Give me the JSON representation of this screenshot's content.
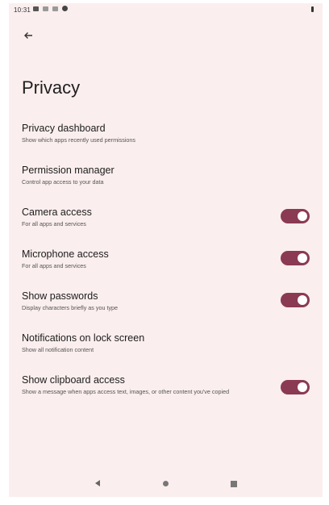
{
  "status_bar": {
    "time": "10:31",
    "icons": [
      "notification-icon",
      "cast-icon",
      "message-icon",
      "settings-gear-icon"
    ],
    "battery_icon": "battery-icon"
  },
  "toolbar": {
    "back_icon": "arrow-back-icon"
  },
  "page": {
    "title": "Privacy"
  },
  "settings": [
    {
      "title": "Privacy dashboard",
      "subtitle": "Show which apps recently used permissions",
      "toggle": null
    },
    {
      "title": "Permission manager",
      "subtitle": "Control app access to your data",
      "toggle": null
    },
    {
      "title": "Camera access",
      "subtitle": "For all apps and services",
      "toggle": true
    },
    {
      "title": "Microphone access",
      "subtitle": "For all apps and services",
      "toggle": true
    },
    {
      "title": "Show passwords",
      "subtitle": "Display characters briefly as you type",
      "toggle": true
    },
    {
      "title": "Notifications on lock screen",
      "subtitle": "Show all notification content",
      "toggle": null
    },
    {
      "title": "Show clipboard access",
      "subtitle": "Show a message when apps access text, images, or other content you've copied",
      "toggle": true
    }
  ],
  "colors": {
    "background": "#fbeeee",
    "toggle_on": "#8b3a53"
  },
  "nav_bar": {
    "buttons": [
      "back-triangle-icon",
      "home-circle-icon",
      "recents-square-icon"
    ]
  }
}
